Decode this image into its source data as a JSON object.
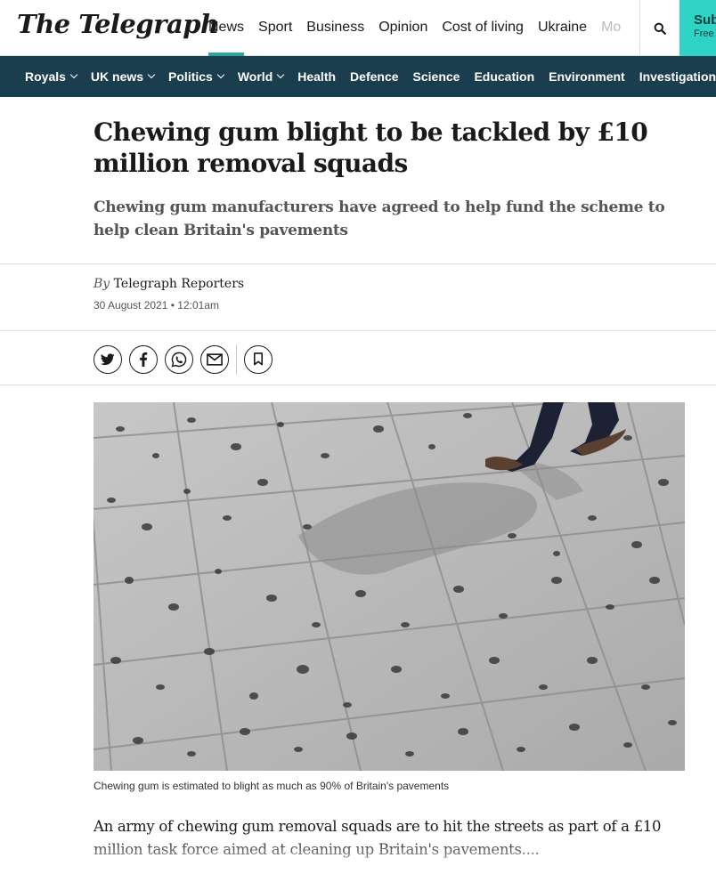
{
  "header": {
    "logo": "The Telegraph",
    "nav": [
      {
        "label": "News",
        "active": true
      },
      {
        "label": "Sport"
      },
      {
        "label": "Business"
      },
      {
        "label": "Opinion"
      },
      {
        "label": "Cost of living"
      },
      {
        "label": "Ukraine"
      },
      {
        "label": "Mo"
      }
    ],
    "search_icon": "search-icon",
    "subscribe": {
      "title": "Sub",
      "subtitle": "Free"
    }
  },
  "section_nav": [
    {
      "label": "Royals",
      "dropdown": true
    },
    {
      "label": "UK news",
      "dropdown": true
    },
    {
      "label": "Politics",
      "dropdown": true
    },
    {
      "label": "World",
      "dropdown": true
    },
    {
      "label": "Health"
    },
    {
      "label": "Defence"
    },
    {
      "label": "Science"
    },
    {
      "label": "Education"
    },
    {
      "label": "Environment"
    },
    {
      "label": "Investigations",
      "dropdown": true
    }
  ],
  "article": {
    "headline": "Chewing gum blight to be tackled by £10 million removal squads",
    "standfirst": "Chewing gum manufacturers have agreed to help fund the scheme to help clean Britain's pavements",
    "by": "By",
    "author": "Telegraph Reporters",
    "date": "30 August 2021 • 12:01am",
    "share": [
      "twitter-icon",
      "facebook-icon",
      "whatsapp-icon",
      "email-icon"
    ],
    "save_icon": "bookmark-icon",
    "image_caption": "Chewing gum is estimated to blight as much as 90% of Britain's pavements",
    "body": "An army of chewing gum removal squads are to hit the streets as part of a £10 million task force aimed at cleaning up Britain's pavements...."
  },
  "colors": {
    "accent": "#2ba59e",
    "section_nav_bg": "#1b3e4e",
    "subscribe_bg": "#2ed3c6"
  }
}
